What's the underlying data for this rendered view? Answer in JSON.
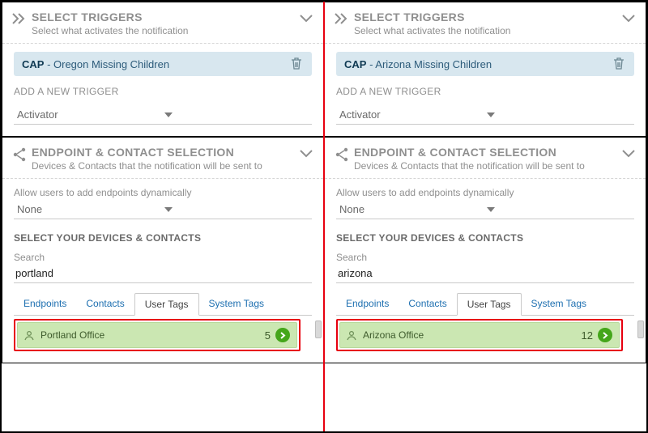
{
  "panels": {
    "triggers": {
      "title": "SELECT TRIGGERS",
      "subtitle": "Select what activates the notification",
      "addNew": "ADD A NEW TRIGGER",
      "activator": "Activator"
    },
    "endpoints": {
      "title": "ENDPOINT & CONTACT SELECTION",
      "subtitle": "Devices & Contacts that the notification will be sent to",
      "dynamicLabel": "Allow users to add endpoints dynamically",
      "dynamicValue": "None",
      "selectHeading": "SELECT YOUR DEVICES & CONTACTS",
      "searchLabel": "Search",
      "tabs": {
        "endpoints": "Endpoints",
        "contacts": "Contacts",
        "userTags": "User Tags",
        "systemTags": "System Tags"
      }
    }
  },
  "left": {
    "trigger": {
      "prefix": "CAP",
      "suffix": " - Oregon Missing Children"
    },
    "searchValue": "portland",
    "result": {
      "name": "Portland Office",
      "count": "5"
    }
  },
  "right": {
    "trigger": {
      "prefix": "CAP",
      "suffix": " - Arizona Missing Children"
    },
    "searchValue": "arizona",
    "result": {
      "name": "Arizona Office",
      "count": "12"
    }
  }
}
